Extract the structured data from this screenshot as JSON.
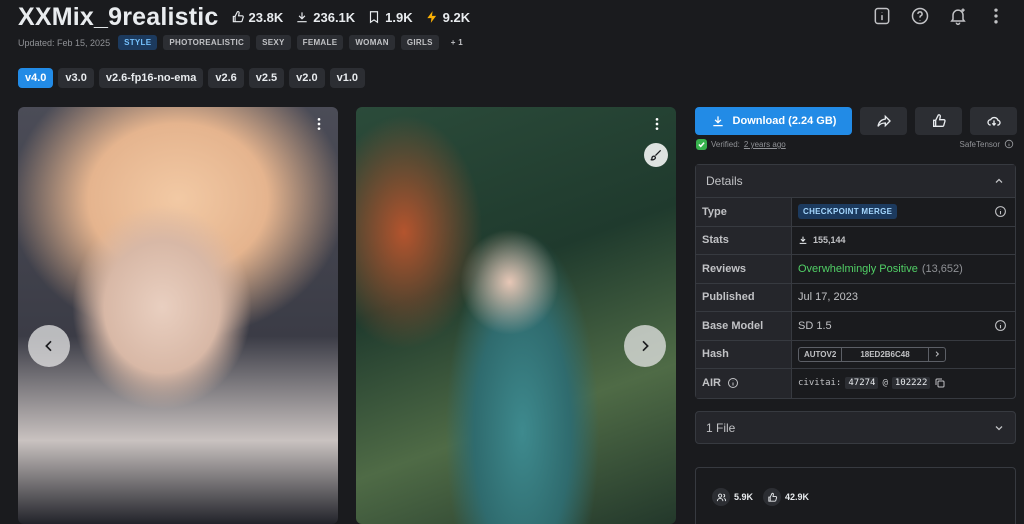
{
  "header": {
    "title": "XXMix_9realistic",
    "stats": [
      {
        "icon": "thumbs-up-icon",
        "value": "23.8K"
      },
      {
        "icon": "download-icon",
        "value": "236.1K"
      },
      {
        "icon": "bookmark-icon",
        "value": "1.9K"
      },
      {
        "icon": "bolt-icon",
        "value": "9.2K"
      }
    ],
    "updated": "Updated: Feb 15, 2025",
    "tags": [
      "STYLE",
      "PHOTOREALISTIC",
      "SEXY",
      "FEMALE",
      "WOMAN",
      "GIRLS"
    ],
    "more_tags": "+ 1"
  },
  "versions": [
    "v4.0",
    "v3.0",
    "v2.6-fp16-no-ema",
    "v2.6",
    "v2.5",
    "v2.0",
    "v1.0"
  ],
  "download": {
    "label": "Download (2.24 GB)",
    "verified_prefix": "Verified:",
    "verified_time": "2 years ago",
    "safetensor": "SafeTensor"
  },
  "details": {
    "title": "Details",
    "type_label": "Type",
    "type_value": "CHECKPOINT MERGE",
    "stats_label": "Stats",
    "stats_value": "155,144",
    "reviews_label": "Reviews",
    "reviews_value": "Overwhelmingly Positive",
    "reviews_count": "(13,652)",
    "published_label": "Published",
    "published_value": "Jul 17, 2023",
    "base_label": "Base Model",
    "base_value": "SD 1.5",
    "hash_label": "Hash",
    "hash_type": "AUTOV2",
    "hash_value": "18ED2B6C48",
    "air_label": "AIR",
    "air_prefix": "civitai:",
    "air_model": "47274",
    "air_at": "@",
    "air_version": "102222"
  },
  "files": {
    "label": "1 File"
  },
  "creator": {
    "followers": "5.9K",
    "likes": "42.9K"
  },
  "colors": {
    "accent": "#228be6",
    "green": "#51cf66",
    "bg": "#1a1b1e"
  }
}
